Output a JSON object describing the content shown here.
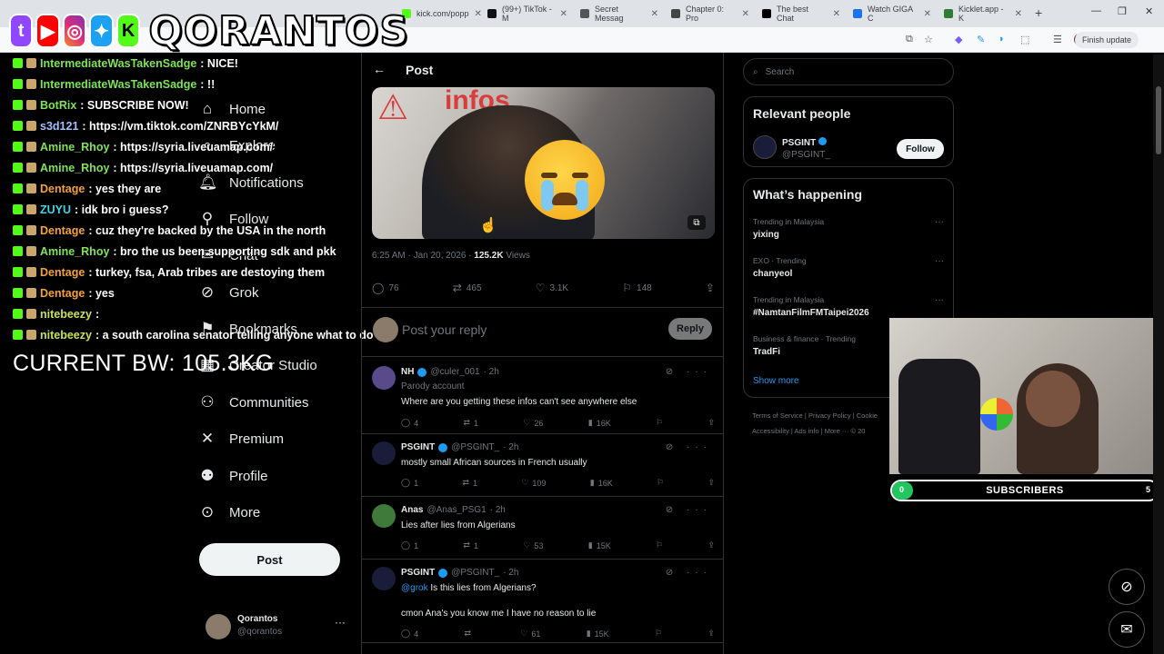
{
  "browser": {
    "tabs": [
      {
        "label": "kick.com/popp",
        "color": "#53fc18"
      },
      {
        "label": "(99+) TikTok - M",
        "color": "#000000"
      },
      {
        "label": "Secret Messag",
        "color": "#202124"
      },
      {
        "label": "Chapter 0: Pro",
        "color": "#202124"
      },
      {
        "label": "The best Chat",
        "color": "#000000"
      },
      {
        "label": "Watch GIGA C",
        "color": "#1a73e8"
      },
      {
        "label": "Kicklet.app - K",
        "color": "#2e7d32"
      }
    ],
    "finish_update": "Finish update"
  },
  "overlay": {
    "brand": "QORANTOS",
    "chat": [
      {
        "name": "IntermediateWasTakenSadge",
        "msg": ": NICE!",
        "color": "#7fe35a"
      },
      {
        "name": "IntermediateWasTakenSadge",
        "msg": ": !!",
        "color": "#7fe35a"
      },
      {
        "name": "BotRix",
        "msg": ": SUBSCRIBE NOW!",
        "color": "#7fe35a"
      },
      {
        "name": "s3d121",
        "msg": ": https://vm.tiktok.com/ZNRBYcYkM/",
        "color": "#9ec1ff"
      },
      {
        "name": "Amine_Rhoy",
        "msg": ": https://syria.liveuamap.com/",
        "color": "#7fe35a"
      },
      {
        "name": "Amine_Rhoy",
        "msg": ": https://syria.liveuamap.com/",
        "color": "#7fe35a"
      },
      {
        "name": "Dentage",
        "msg": ": yes they are",
        "color": "#f4a13a"
      },
      {
        "name": "ZUYU",
        "msg": ": idk bro i guess?",
        "color": "#3fd5e8"
      },
      {
        "name": "Dentage",
        "msg": ": cuz they're backed by the USA in the north",
        "color": "#f4a13a"
      },
      {
        "name": "Amine_Rhoy",
        "msg": ": bro the us been supporting sdk and pkk",
        "color": "#7fe35a"
      },
      {
        "name": "Dentage",
        "msg": ": turkey, fsa, Arab tribes are destoying them",
        "color": "#f4a13a"
      },
      {
        "name": "Dentage",
        "msg": ": yes",
        "color": "#f4a13a"
      },
      {
        "name": "nitebeezy",
        "msg": ":",
        "color": "#c8e25a"
      },
      {
        "name": "nitebeezy",
        "msg": ": a south carolina senator telling anyone what to do",
        "color": "#c8e25a"
      }
    ],
    "bodyweight": "CURRENT BW: 105.3KG",
    "subs": {
      "start": "0",
      "label": "SUBSCRIBERS",
      "end": "5",
      "progress": 0.08
    }
  },
  "nav": {
    "items": [
      {
        "label": "Home",
        "icon": "home-icon"
      },
      {
        "label": "Explore",
        "icon": "search-icon"
      },
      {
        "label": "Notifications",
        "icon": "bell-icon"
      },
      {
        "label": "Follow",
        "icon": "follow-icon"
      },
      {
        "label": "Chat",
        "icon": "chat-icon"
      },
      {
        "label": "Grok",
        "icon": "grok-icon"
      },
      {
        "label": "Bookmarks",
        "icon": "bookmark-icon"
      },
      {
        "label": "Creator Studio",
        "icon": "studio-icon"
      },
      {
        "label": "Communities",
        "icon": "communities-icon"
      },
      {
        "label": "Premium",
        "icon": "x-icon"
      },
      {
        "label": "Profile",
        "icon": "profile-icon"
      },
      {
        "label": "More",
        "icon": "more-icon"
      }
    ],
    "post_button": "Post",
    "account": {
      "name": "Qorantos",
      "handle": "@qorantos"
    }
  },
  "post": {
    "header": "Post",
    "media_text": "infos",
    "time": "6:25 AM · Jan 20, 2026 ·",
    "views": "125.2K",
    "views_label": "Views",
    "actions": {
      "replies": "76",
      "reposts": "465",
      "likes": "3.1K",
      "bookmarks": "148"
    },
    "reply_placeholder": "Post your reply",
    "reply_button": "Reply"
  },
  "replies": [
    {
      "name": "NH",
      "handle": "@culer_001",
      "time": "· 2h",
      "sub": "Parody account",
      "mention": "",
      "text": "Where are you getting these infos can't see anywhere else",
      "text2": "",
      "replies": "4",
      "reposts": "1",
      "likes": "26",
      "views": "16K",
      "avatar_color": "#5a4a8a",
      "verified": true
    },
    {
      "name": "PSGINT",
      "handle": "@PSGINT_",
      "time": "· 2h",
      "sub": "",
      "mention": "",
      "text": "mostly small African sources in French usually",
      "text2": "",
      "replies": "1",
      "reposts": "1",
      "likes": "109",
      "views": "16K",
      "avatar_color": "#1a1d3a",
      "verified": true
    },
    {
      "name": "Anas",
      "handle": "@Anas_PSG1",
      "time": "· 2h",
      "sub": "",
      "mention": "",
      "text": "Lies after lies from Algerians",
      "text2": "",
      "replies": "1",
      "reposts": "1",
      "likes": "53",
      "views": "15K",
      "avatar_color": "#3f7a3a",
      "verified": false
    },
    {
      "name": "PSGINT",
      "handle": "@PSGINT_",
      "time": "· 2h",
      "sub": "",
      "mention": "@grok",
      "text": "Is this lies from Algerians?",
      "text2": "cmon Ana's you know me I have no reason to lie",
      "replies": "4",
      "reposts": "",
      "likes": "61",
      "views": "15K",
      "avatar_color": "#1a1d3a",
      "verified": true
    }
  ],
  "sidebar": {
    "search_placeholder": "Search",
    "relevant_title": "Relevant people",
    "relevant": {
      "name": "PSGINT",
      "handle": "@PSGINT_",
      "follow": "Follow"
    },
    "happening_title": "What’s happening",
    "trends": [
      {
        "context": "Trending in Malaysia",
        "title": "yixing"
      },
      {
        "context": "EXO · Trending",
        "title": "chanyeol"
      },
      {
        "context": "Trending in Malaysia",
        "title": "#NamtanFilmFMTaipei2026"
      },
      {
        "context": "Business & finance · Trending",
        "title": "TradFi"
      }
    ],
    "show_more": "Show more",
    "footer1": "Terms of Service   |   Privacy Policy   |   Cookie",
    "footer2": "Accessibility   |   Ads info   |   More ···   © 20"
  },
  "colors": {
    "accent": "#1d9bf0",
    "background": "#000000",
    "subs_fill": "#22c55e"
  }
}
